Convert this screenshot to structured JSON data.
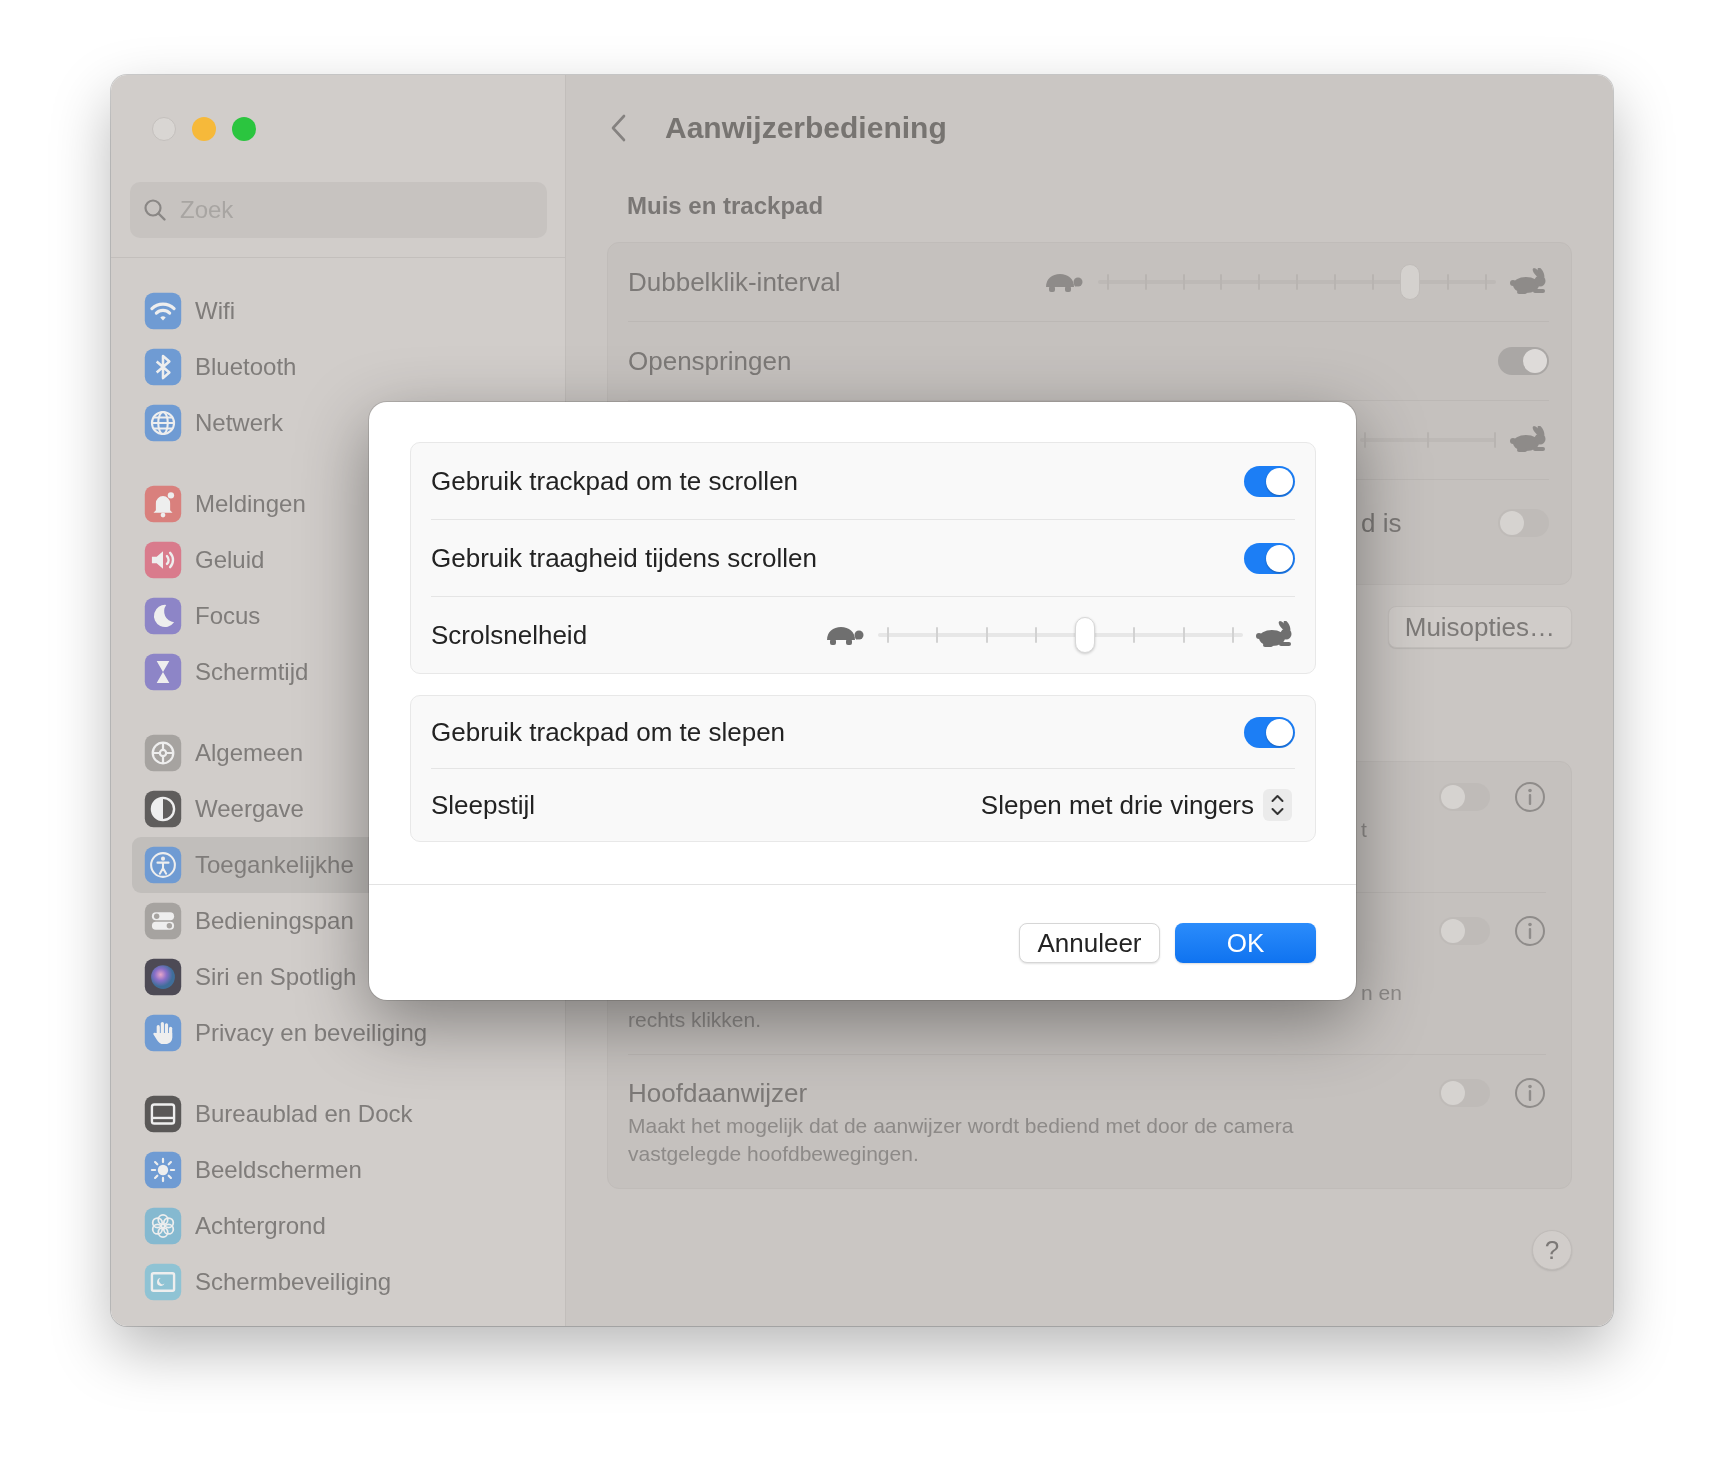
{
  "sidebar": {
    "search": {
      "placeholder": "Zoek"
    },
    "groups": [
      {
        "items": [
          {
            "label": "Wifi",
            "selected": false
          },
          {
            "label": "Bluetooth",
            "selected": false
          },
          {
            "label": "Netwerk",
            "selected": false
          }
        ]
      },
      {
        "items": [
          {
            "label": "Meldingen",
            "selected": false
          },
          {
            "label": "Geluid",
            "selected": false
          },
          {
            "label": "Focus",
            "selected": false
          },
          {
            "label": "Schermtijd",
            "selected": false
          }
        ]
      },
      {
        "items": [
          {
            "label": "Algemeen",
            "selected": false
          },
          {
            "label": "Weergave",
            "selected": false
          },
          {
            "label": "Toegankelijkhe",
            "selected": true
          },
          {
            "label": "Bedieningspan",
            "selected": false
          },
          {
            "label": "Siri en Spotligh",
            "selected": false
          },
          {
            "label": "Privacy en beveiliging",
            "selected": false
          }
        ]
      },
      {
        "items": [
          {
            "label": "Bureaublad en Dock",
            "selected": false
          },
          {
            "label": "Beeldschermen",
            "selected": false
          },
          {
            "label": "Achtergrond",
            "selected": false
          },
          {
            "label": "Schermbeveiliging",
            "selected": false
          }
        ]
      }
    ]
  },
  "pane": {
    "title": "Aanwijzerbediening",
    "section": "Muis en trackpad",
    "card_1": [
      {
        "kind": "slider",
        "label": "Dubbelklik-interval",
        "level": 0.8
      },
      {
        "kind": "toggle",
        "label": "Openspringen",
        "on": true
      },
      {
        "kind": "covered-slider"
      },
      {
        "kind": "covered-toggle",
        "label": "d is",
        "on": false
      }
    ],
    "buttons": [
      {
        "label": "Muisopties…"
      }
    ],
    "card_2": [
      {
        "kind": "covered-option",
        "on": false,
        "fragments": [
          "t"
        ]
      },
      {
        "kind": "covered-option",
        "on": false,
        "fragments": [
          "n en",
          "rechts klikken."
        ]
      },
      {
        "kind": "option",
        "label": "Hoofdaanwijzer",
        "on": false,
        "description": "Maakt het mogelijk dat de aanwijzer wordt bediend met door de camera\nvastgelegde hoofdbewegingen."
      }
    ],
    "help": "?"
  },
  "dialog": {
    "groups": [
      {
        "rows": [
          {
            "kind": "toggle",
            "label": "Gebruik trackpad om te scrollen",
            "on": true
          },
          {
            "kind": "toggle",
            "label": "Gebruik traagheid tijdens scrollen",
            "on": true
          },
          {
            "kind": "slider",
            "label": "Scrolsnelheid",
            "level": 0.57
          }
        ]
      },
      {
        "rows": [
          {
            "kind": "toggle",
            "label": "Gebruik trackpad om te slepen",
            "on": true
          },
          {
            "kind": "popup",
            "label": "Sleepstijl",
            "value": "Slepen met drie vingers"
          }
        ]
      }
    ],
    "buttons": [
      {
        "kind": "cancel",
        "label": "Annuleer"
      },
      {
        "kind": "default",
        "label": "OK"
      }
    ]
  }
}
